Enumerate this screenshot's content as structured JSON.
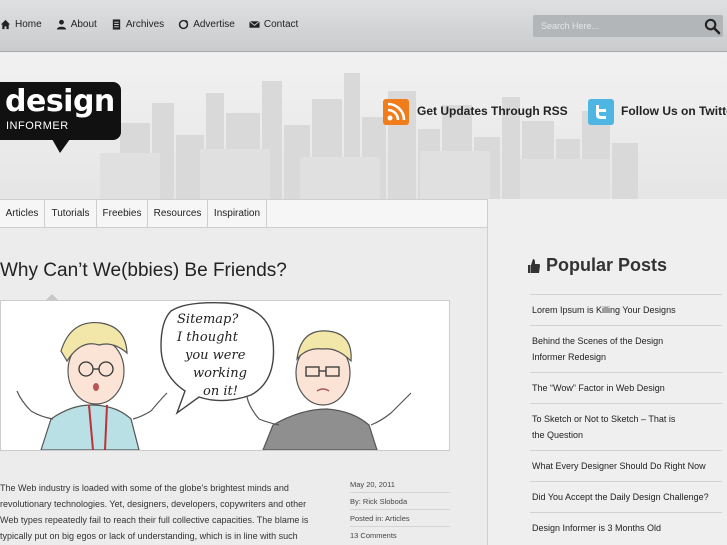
{
  "nav": {
    "items": [
      {
        "label": "Home",
        "icon": "home-icon"
      },
      {
        "label": "About",
        "icon": "user-icon"
      },
      {
        "label": "Archives",
        "icon": "document-icon"
      },
      {
        "label": "Advertise",
        "icon": "refresh-icon"
      },
      {
        "label": "Contact",
        "icon": "envelope-icon"
      }
    ]
  },
  "search": {
    "placeholder": "Search Here..."
  },
  "brand": {
    "word": "design",
    "sub": "INFORMER"
  },
  "header": {
    "rss_label": "Get Updates Through RSS",
    "twitter_label": "Follow Us on Twitter"
  },
  "categories": [
    "Articles",
    "Tutorials",
    "Freebies",
    "Resources",
    "Inspiration"
  ],
  "post": {
    "title": "Why Can’t We(bbies) Be Friends?",
    "comic_text": [
      "Sitemap?",
      "I thought",
      "you were",
      "working",
      "on it!"
    ],
    "excerpt": "The Web industry is loaded with some of the globe’s brightest minds and revolutionary technologies. Yet, designers, developers, copywriters and other Web types repeatedly fail to reach their full collective capacities. The blame is typically put on big egos or lack of understanding, which is in line with such",
    "meta": {
      "date": "May 20, 2011",
      "author": "By: Rick Sloboda",
      "posted_in": "Posted in: Articles",
      "comments": "13 Comments"
    }
  },
  "sidebar": {
    "title": "Popular Posts",
    "items": [
      "Lorem Ipsum is Killing Your Designs",
      "Behind the Scenes of the Design Informer Redesign",
      "The “Wow” Factor in Web Design",
      "To Sketch or Not to Sketch – That is the Question",
      "What Every Designer Should Do Right Now",
      "Did You Accept the Daily Design Challenge?",
      "Design Informer is 3 Months Old"
    ]
  },
  "colors": {
    "rss": "#f07c1b",
    "twitter": "#4fb6e3",
    "logo_bg": "#111111"
  }
}
